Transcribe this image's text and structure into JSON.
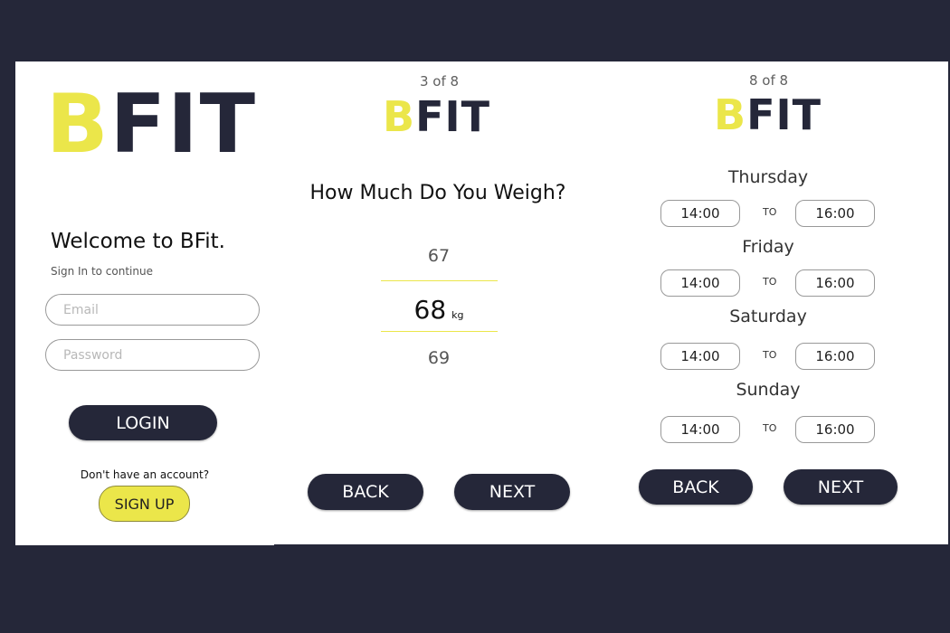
{
  "brand": {
    "b": "B",
    "fit": "FIT"
  },
  "login_screen": {
    "welcome": "Welcome to BFit.",
    "subtitle": "Sign In to continue",
    "email_placeholder": "Email",
    "password_placeholder": "Password",
    "login_label": "LOGIN",
    "no_account": "Don't have an account?",
    "signup_label": "SIGN UP"
  },
  "weight_screen": {
    "step": "3 of 8",
    "question": "How Much Do You Weigh?",
    "prev_value": "67",
    "current_value": "68",
    "unit": "kg",
    "next_value": "69",
    "back_label": "BACK",
    "next_label": "NEXT"
  },
  "schedule_screen": {
    "step": "8 of 8",
    "to_label": "TO",
    "days": [
      {
        "name": "Thursday",
        "from": "14:00",
        "to": "16:00"
      },
      {
        "name": "Friday",
        "from": "14:00",
        "to": "16:00"
      },
      {
        "name": "Saturday",
        "from": "14:00",
        "to": "16:00"
      },
      {
        "name": "Sunday",
        "from": "14:00",
        "to": "16:00"
      }
    ],
    "back_label": "BACK",
    "next_label": "NEXT"
  },
  "colors": {
    "accent": "#ebe64a",
    "dark": "#252739",
    "background": "#252739",
    "panel": "#ffffff"
  }
}
